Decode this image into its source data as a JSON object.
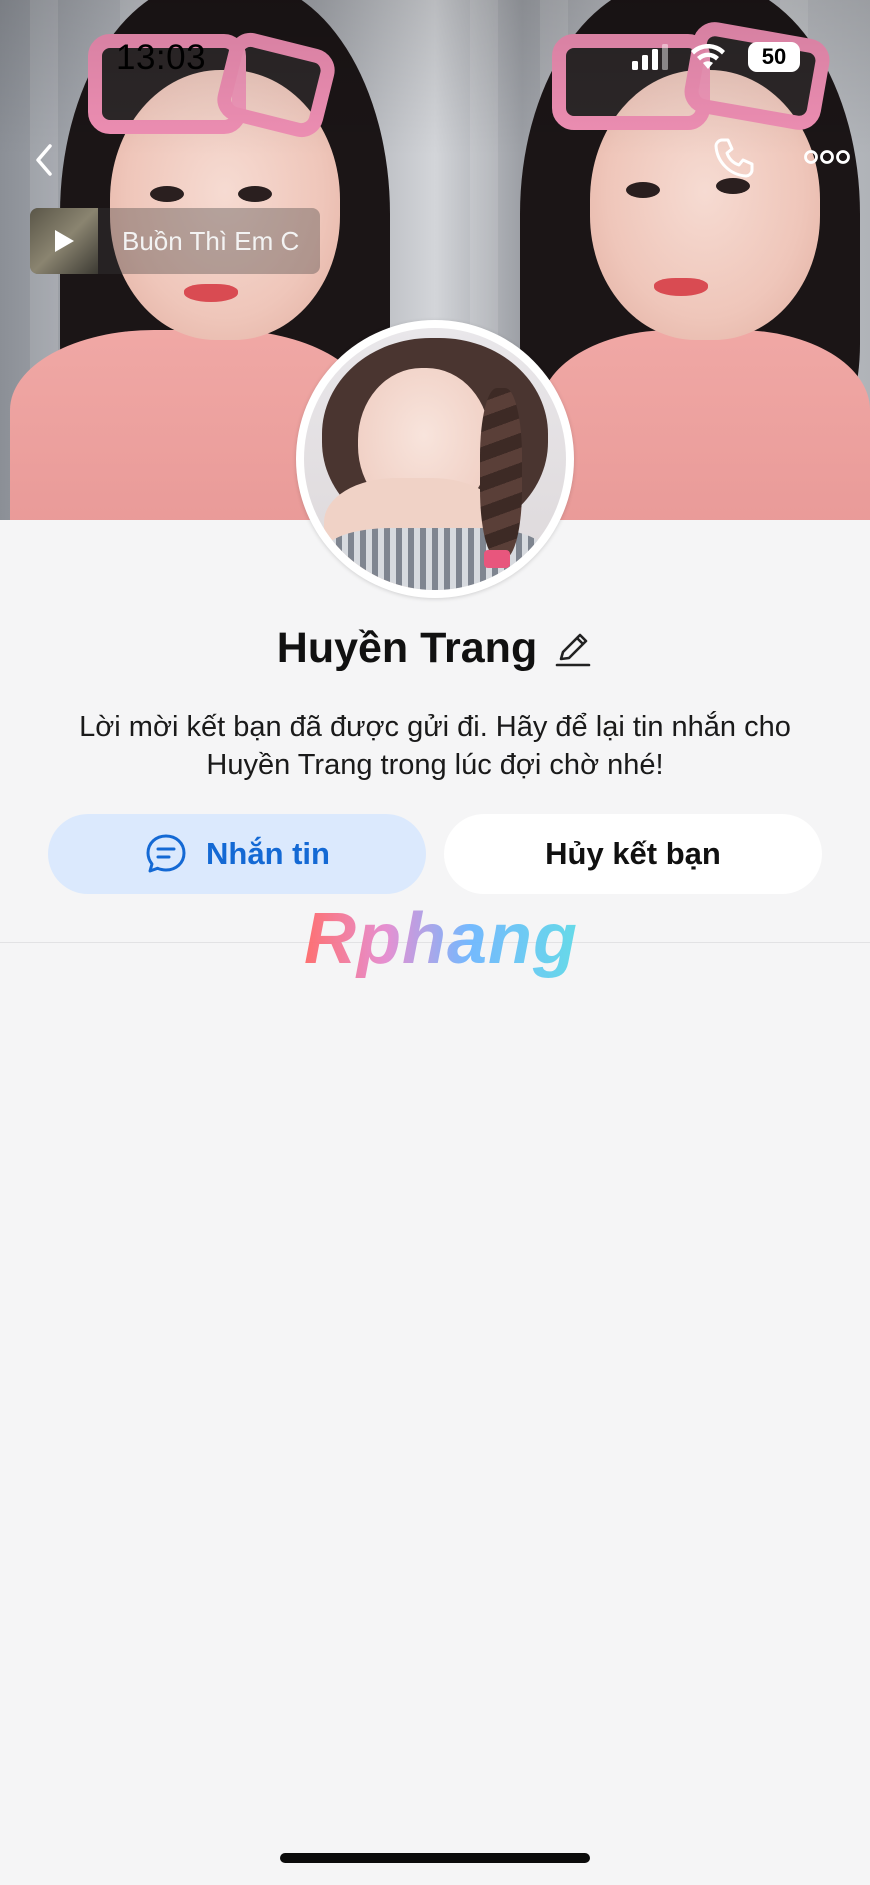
{
  "status_bar": {
    "time": "13:03",
    "battery": "50"
  },
  "music": {
    "title": "Buồn Thì Em C"
  },
  "profile": {
    "name": "Huyền Trang",
    "description": "Lời mời kết bạn đã được gửi đi. Hãy để lại tin nhắn cho Huyền Trang trong lúc đợi chờ nhé!"
  },
  "actions": {
    "message_label": "Nhắn tin",
    "cancel_label": "Hủy kết bạn"
  },
  "watermark": {
    "text": "Rphang"
  },
  "icons": {
    "back": "chevron-left-icon",
    "call": "phone-icon",
    "more": "more-icon",
    "edit": "pencil-icon",
    "chat": "chat-bubble-icon",
    "play": "play-icon",
    "signal": "signal-icon",
    "wifi": "wifi-icon"
  },
  "colors": {
    "accent": "#1469d4",
    "message_button_bg": "#dbe9fd",
    "background": "#f5f5f6"
  }
}
